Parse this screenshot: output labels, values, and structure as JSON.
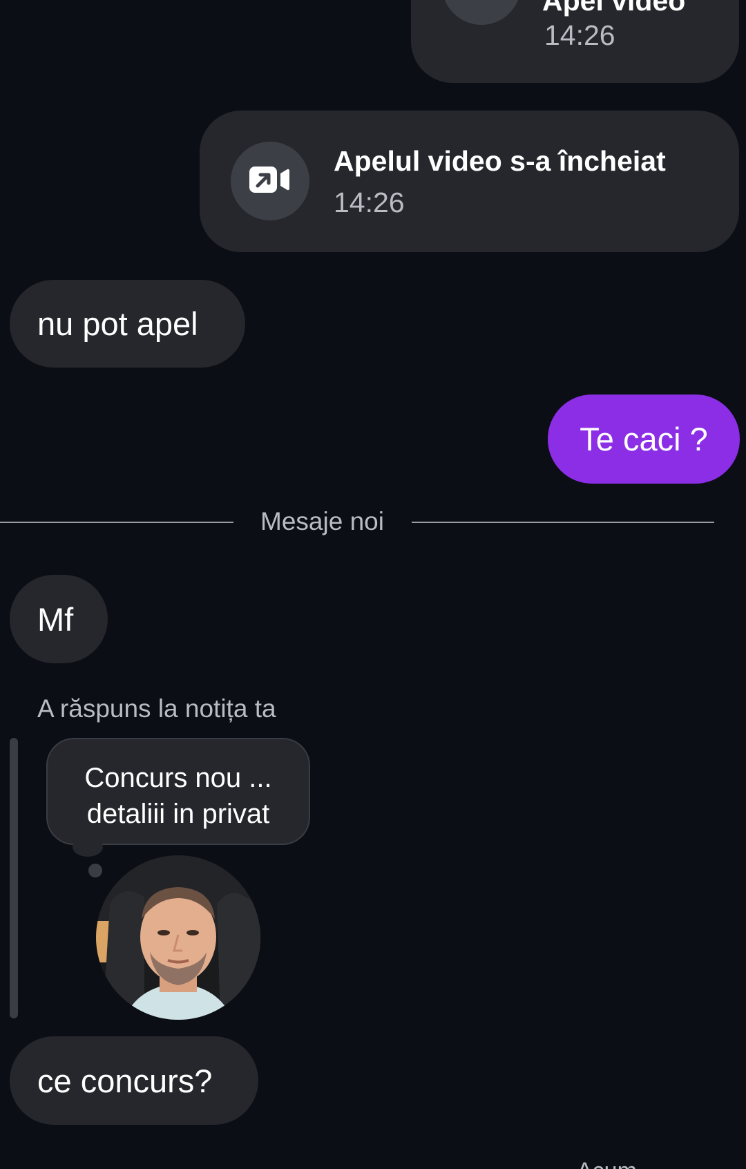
{
  "call_top": {
    "title": "Apel video",
    "time": "14:26",
    "icon": "video-camera-icon"
  },
  "call_ended": {
    "title": "Apelul video s-a încheiat",
    "time": "14:26",
    "icon": "video-call-outgoing-icon"
  },
  "messages": {
    "nu_pot_apel": "nu pot apel",
    "te_caci": "Te caci ?",
    "mf": "Mf",
    "ce_concurs": "ce concurs?"
  },
  "divider": {
    "label": "Mesaje noi"
  },
  "note_reply": {
    "label": "A răspuns la notița ta",
    "note_line1": "Concurs nou ...",
    "note_line2": "detaliii in privat",
    "avatar_icon": "profile-photo"
  },
  "bottom_partial": {
    "text": "Acum"
  },
  "colors": {
    "background": "#0b0e14",
    "incoming_bubble": "#25272d",
    "outgoing_bubble": "#8c2ee6",
    "secondary_text": "#b9bcc3"
  }
}
